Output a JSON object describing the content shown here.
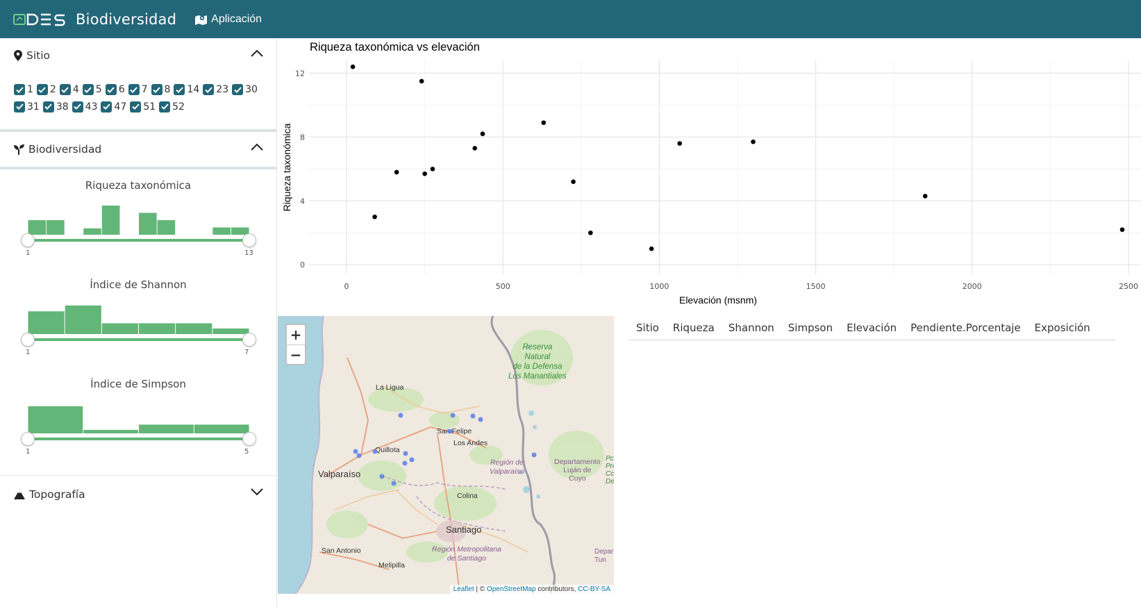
{
  "navbar": {
    "logo_text": "ODES",
    "brand": "Biodiversidad",
    "app_link": "Aplicación"
  },
  "sidebar": {
    "sitio": {
      "title": "Sitio",
      "sites": [
        "1",
        "2",
        "4",
        "5",
        "6",
        "7",
        "8",
        "14",
        "23",
        "30",
        "31",
        "38",
        "43",
        "47",
        "51",
        "52"
      ]
    },
    "biodiversidad": {
      "title": "Biodiversidad",
      "sliders": [
        {
          "title": "Riqueza taxonómica",
          "min_label": "1",
          "max_label": "13",
          "hist": [
            0.5,
            0.5,
            0,
            0.22,
            1,
            0,
            0.75,
            0.5,
            0,
            0,
            0.25,
            0.25
          ]
        },
        {
          "title": "Índice de Shannon",
          "min_label": "1",
          "max_label": "7",
          "hist": [
            0.78,
            0.98,
            0.37,
            0.37,
            0.37,
            0.19
          ]
        },
        {
          "title": "Índice de Simpson",
          "min_label": "1",
          "max_label": "5",
          "hist": [
            0.93,
            0.12,
            0.3,
            0.3
          ]
        }
      ]
    },
    "topografia": {
      "title": "Topografía"
    }
  },
  "chart_data": {
    "type": "scatter",
    "title": "Riqueza taxonómica vs elevación",
    "xlabel": "Elevación (msnm)",
    "ylabel": "Riqueza taxonómica",
    "xlim": [
      -120,
      2540
    ],
    "ylim": [
      -0.6,
      12.8
    ],
    "xticks": [
      0,
      500,
      1000,
      1500,
      2000,
      2500
    ],
    "yticks": [
      0,
      4,
      8,
      12
    ],
    "grid": true,
    "points": [
      {
        "x": 20,
        "y": 12.4
      },
      {
        "x": 90,
        "y": 3.0
      },
      {
        "x": 160,
        "y": 5.8
      },
      {
        "x": 240,
        "y": 11.5
      },
      {
        "x": 250,
        "y": 5.7
      },
      {
        "x": 275,
        "y": 6.0
      },
      {
        "x": 410,
        "y": 7.3
      },
      {
        "x": 435,
        "y": 8.2
      },
      {
        "x": 630,
        "y": 8.9
      },
      {
        "x": 725,
        "y": 5.2
      },
      {
        "x": 780,
        "y": 2.0
      },
      {
        "x": 975,
        "y": 1.0
      },
      {
        "x": 1065,
        "y": 7.6
      },
      {
        "x": 1300,
        "y": 7.7
      },
      {
        "x": 1850,
        "y": 4.3
      },
      {
        "x": 2480,
        "y": 2.2
      }
    ]
  },
  "map": {
    "zoom_in": "+",
    "zoom_out": "−",
    "labels": {
      "reserva": [
        "Reserva",
        "Natural",
        "de la Defensa",
        "Los Manantiales"
      ],
      "la_ligua": "La Ligua",
      "san_felipe": "San Felipe",
      "los_andes": "Los Andes",
      "quillota": "Quillota",
      "valparaiso": "Valparaíso",
      "region_valparaiso": [
        "Región de",
        "Valparaíso"
      ],
      "departamento": [
        "Departamento",
        "Luján de",
        "Cuyo"
      ],
      "colina": "Colina",
      "santiago": "Santiago",
      "region_metro": [
        "Región Metropolitana",
        "de Santiago"
      ],
      "san_antonio": "San Antonio",
      "melipilla": "Melipilla",
      "edge_right": [
        "Pc",
        "Pro",
        "Cc",
        "De"
      ],
      "depart_right": [
        "Depart",
        "Tun"
      ]
    },
    "attribution": {
      "leaflet": "Leaflet",
      "sep": " | © ",
      "osm": "OpenStreetMap",
      "contributors": " contributors, ",
      "license": "CC-BY-SA"
    }
  },
  "table": {
    "headers": [
      "Sitio",
      "Riqueza",
      "Shannon",
      "Simpson",
      "Elevación",
      "Pendiente.Porcentaje",
      "Exposición"
    ]
  },
  "colors": {
    "navbar": "#236678",
    "accent_green": "#62b677",
    "checkbox": "#236678",
    "map_marker": "#5b7fe6",
    "water": "#aad3df"
  }
}
